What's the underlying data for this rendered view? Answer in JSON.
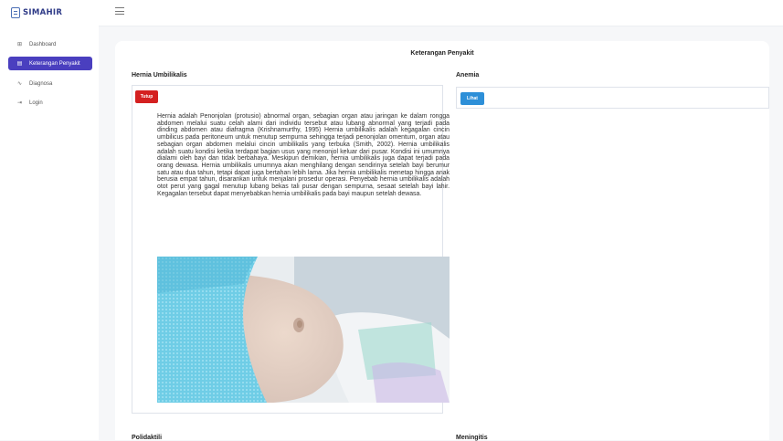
{
  "app": {
    "logo_text": "SIMAHIR"
  },
  "sidebar": {
    "items": [
      {
        "label": "Dashboard",
        "icon": "grid-icon",
        "active": false
      },
      {
        "label": "Keterangan Penyakit",
        "icon": "document-icon",
        "active": true
      },
      {
        "label": "Diagnosa",
        "icon": "pulse-icon",
        "active": false
      },
      {
        "label": "Login",
        "icon": "login-icon",
        "active": false
      }
    ]
  },
  "main": {
    "title": "Keterangan Penyakit",
    "sections": [
      {
        "name": "Hernia Umbilikalis",
        "button": "Tutup",
        "description": "Hernia adalah Penonjolan (protusio) abnormal organ, sebagian organ atau jaringan ke dalam rongga abdomen melalui suatu celah alami dari individu tersebut atau lubang abnormal yang terjadi pada dinding abdomen atau diafragma (Krishnamurthy, 1995) Hernia umbilikalis adalah kegagalan cincin umbilicus pada peritoneum untuk menutup sempurna sehingga terjadi penonjolan omentum, organ atau sebagian organ abdomen melalui cincin umbilikalis yang terbuka (Smith, 2002). Hernia umbilikalis adalah suatu kondisi ketika terdapat bagian usus yang menonjol keluar dari pusar. Kondisi ini umumnya dialami oleh bayi dan tidak berbahaya. Meskipun demikian, hernia umbilikalis juga dapat terjadi pada orang dewasa. Hernia umbilikalis umumnya akan menghilang dengan sendirinya setelah bayi berumur satu atau dua tahun, tetapi dapat juga bertahan lebih lama. Jika hernia umbilikalis menetap hingga anak berusia empat tahun, disarankan untuk menjalani prosedur operasi. Penyebab hernia umbilikalis adalah otot perut yang gagal menutup lubang bekas tali pusar dengan sempurna, sesaat setelah bayi lahir. Kegagalan tersebut dapat menyebabkan hernia umbilikalis pada bayi maupun setelah dewasa."
      },
      {
        "name": "Anemia",
        "button": "Lihat"
      },
      {
        "name": "Polidaktili"
      },
      {
        "name": "Meningitis"
      }
    ]
  },
  "colors": {
    "sidebar_active": "#4a3fbf",
    "danger": "#d42020",
    "info": "#2d8fd8",
    "logo": "#2e3a87"
  }
}
